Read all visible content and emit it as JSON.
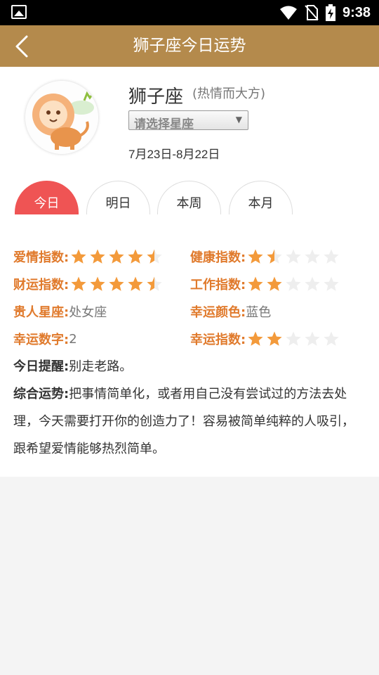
{
  "status_bar": {
    "time": "9:38",
    "icons": [
      "gallery-icon",
      "wifi-icon",
      "no-sim-icon",
      "battery-charging-icon"
    ]
  },
  "app_bar": {
    "title": "狮子座今日运势",
    "back_icon": "chevron-left-icon"
  },
  "sign": {
    "name": "狮子座",
    "description": "(热情而大方)",
    "select_label": "请选择星座",
    "dates": "7月23日-8月22日",
    "avatar_icon": "lion-icon"
  },
  "tabs": [
    {
      "label": "今日",
      "active": true
    },
    {
      "label": "明日",
      "active": false
    },
    {
      "label": "本周",
      "active": false
    },
    {
      "label": "本月",
      "active": false
    }
  ],
  "indices": {
    "love": {
      "label": "爱情指数:",
      "stars": 4.5
    },
    "health": {
      "label": "健康指数:",
      "stars": 1.5
    },
    "wealth": {
      "label": "财运指数:",
      "stars": 4.5
    },
    "work": {
      "label": "工作指数:",
      "stars": 2
    },
    "noble": {
      "label": "贵人星座:",
      "value": "处女座"
    },
    "color": {
      "label": "幸运颜色:",
      "value": "蓝色"
    },
    "number": {
      "label": "幸运数字:",
      "value": "2"
    },
    "luck": {
      "label": "幸运指数:",
      "stars": 2
    }
  },
  "reminder": {
    "label": "今日提醒:",
    "text": "别走老路。"
  },
  "overall": {
    "label": "综合运势:",
    "text": "把事情简单化，或者用自己没有尝试过的方法去处理，今天需要打开你的创造力了！容易被简单纯粹的人吸引，跟希望爱情能够热烈简单。"
  },
  "colors": {
    "app_bar": "#b48a4c",
    "tab_active": "#ef5454",
    "label": "#e07a2c",
    "star_filled": "#f39a3b",
    "star_empty": "#eeeeee"
  }
}
